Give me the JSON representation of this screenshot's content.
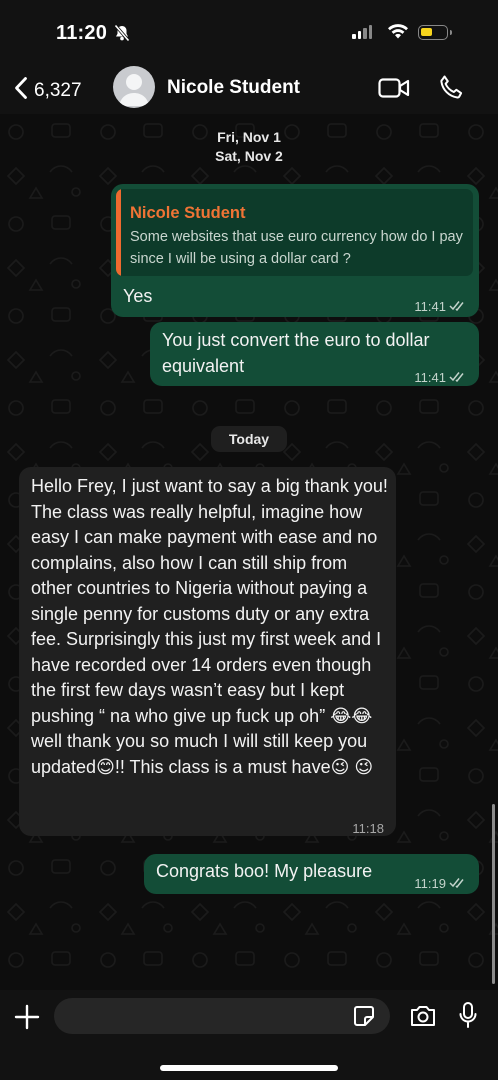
{
  "status": {
    "time": "11:20"
  },
  "header": {
    "back_count": "6,327",
    "contact_name": "Nicole Student"
  },
  "dates": {
    "first": "Fri, Nov 1",
    "second": "Sat, Nov 2",
    "today": "Today"
  },
  "messages": [
    {
      "direction": "outgoing",
      "quote_author": "Nicole Student",
      "quote_text": "Some websites that use euro currency how do I pay since I will be using a dollar card ?",
      "text": "Yes",
      "time": "11:41",
      "status": "read"
    },
    {
      "direction": "outgoing",
      "text": "You just  convert the euro to dollar equivalent",
      "time": "11:41",
      "status": "read"
    },
    {
      "direction": "incoming",
      "text": "Hello Frey, I just want to say a big thank you! The class was really helpful, imagine how easy I can make payment with ease and no complains, also how I can still ship from other countries to Nigeria without paying a single penny for customs duty or any extra fee. Surprisingly this just my first week and I have recorded over 14 orders even though the first few days wasn’t easy but I kept pushing “ na who give up fuck up oh” 😂😂 well thank you so much I will still keep you updated😊!! This class is a must have😉 😉",
      "time": "11:18"
    },
    {
      "direction": "outgoing",
      "text": "Congrats boo! My pleasure",
      "time": "11:19",
      "status": "read"
    }
  ],
  "composer": {
    "placeholder": ""
  },
  "colors": {
    "outgoing_bubble": "#134d37",
    "incoming_bubble": "#202020",
    "quote_accent": "#ee6a2f",
    "battery": "#f7d51d"
  },
  "icons": [
    "bell-slash-icon",
    "signal-icon",
    "wifi-icon",
    "battery-icon",
    "back-chevron-icon",
    "video-call-icon",
    "phone-icon",
    "read-ticks-icon",
    "plus-icon",
    "sticker-icon",
    "camera-icon",
    "microphone-icon"
  ]
}
